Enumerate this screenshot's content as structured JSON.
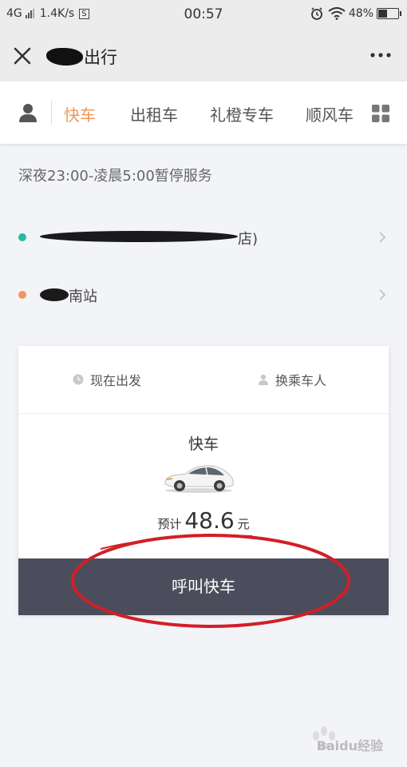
{
  "status_bar": {
    "network": "4G",
    "speed": "1.4K/s",
    "s_badge": "S",
    "time": "00:57",
    "battery": "48%"
  },
  "header": {
    "title_suffix": "出行"
  },
  "tabs": [
    {
      "label": "快车",
      "active": true
    },
    {
      "label": "出租车",
      "active": false
    },
    {
      "label": "礼橙专车",
      "active": false
    },
    {
      "label": "顺风车",
      "active": false
    }
  ],
  "notice": "深夜23:00-凌晨5:00暂停服务",
  "route": {
    "start_tail": "店)",
    "destination_tail": "南站",
    "start_dot_color": "#2bb8a4",
    "end_dot_color": "#f0965a"
  },
  "order_card": {
    "option_time": "现在出发",
    "option_passenger": "换乘车人",
    "car_type": "快车",
    "price_prefix": "预计",
    "price_value": "48.6",
    "price_unit": "元",
    "call_button": "呼叫快车"
  },
  "colors": {
    "accent": "#f0965a",
    "button": "#4c4d5c",
    "annotation": "#d21f26"
  },
  "watermark": "Baidu经验"
}
